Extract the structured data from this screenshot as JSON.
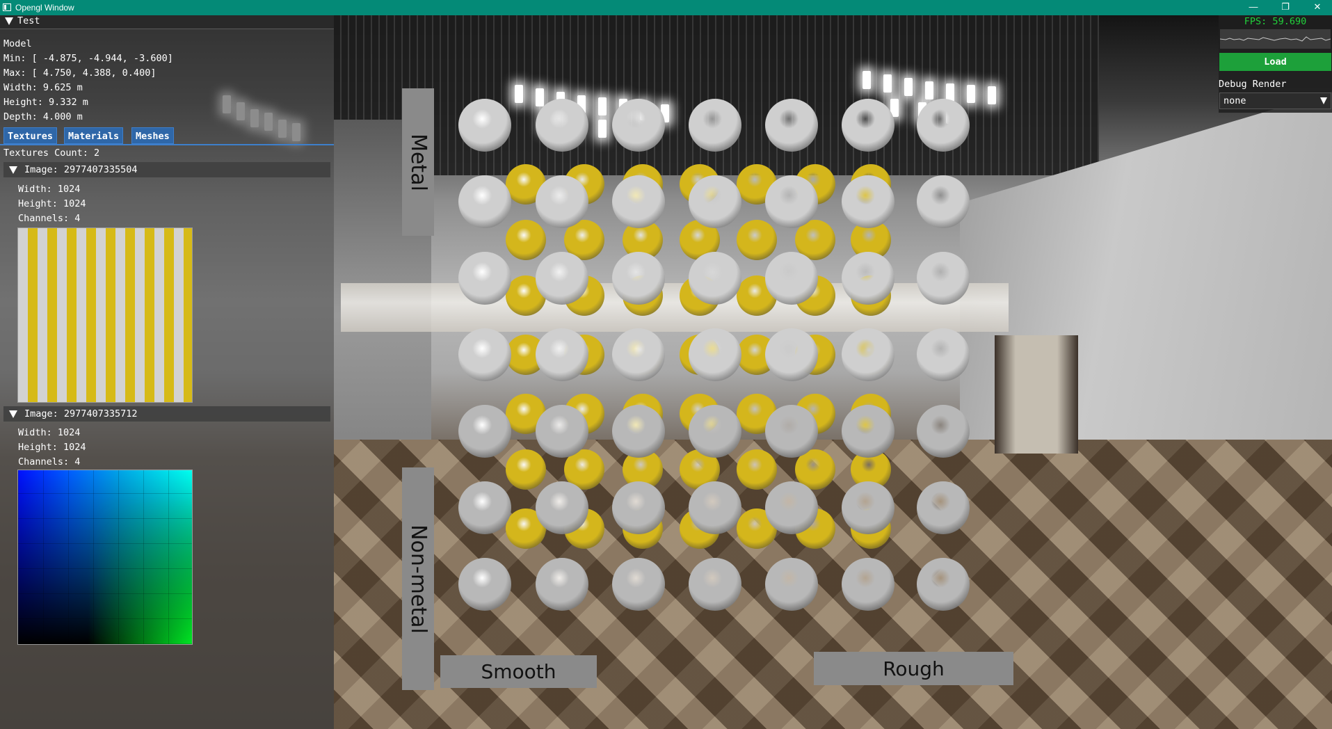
{
  "window": {
    "title": "Opengl Window",
    "minimize": "—",
    "restore": "❐",
    "close": "✕"
  },
  "panel": {
    "header": "Test",
    "model_label": "Model",
    "min": "Min: [ -4.875, -4.944, -3.600]",
    "max": "Max: [ 4.750, 4.388, 0.400]",
    "width": "Width: 9.625 m",
    "height": "Height: 9.332 m",
    "depth": "Depth: 4.000 m",
    "tabs": [
      "Textures",
      "Materials",
      "Meshes"
    ],
    "textures_count": "Textures Count: 2",
    "images": [
      {
        "header": "Image: 2977407335504",
        "width": "Width: 1024",
        "height": "Height: 1024",
        "channels": "Channels: 4"
      },
      {
        "header": "Image: 2977407335712",
        "width": "Width: 1024",
        "height": "Height: 1024",
        "channels": "Channels: 4"
      }
    ]
  },
  "overlay": {
    "fps": "FPS: 59.690",
    "load_button": "Load",
    "debug_render_label": "Debug Render",
    "debug_render_value": "none"
  },
  "scene": {
    "labels": {
      "metal": "Metal",
      "non_metal": "Non-metal",
      "smooth": "Smooth",
      "rough": "Rough"
    },
    "colors": {
      "gold": "#d4b61c",
      "silver": "#cfcfcf",
      "titlebar": "#048a77",
      "tab": "#2f67a8",
      "load": "#1da03a",
      "fps": "#21d13b"
    }
  }
}
